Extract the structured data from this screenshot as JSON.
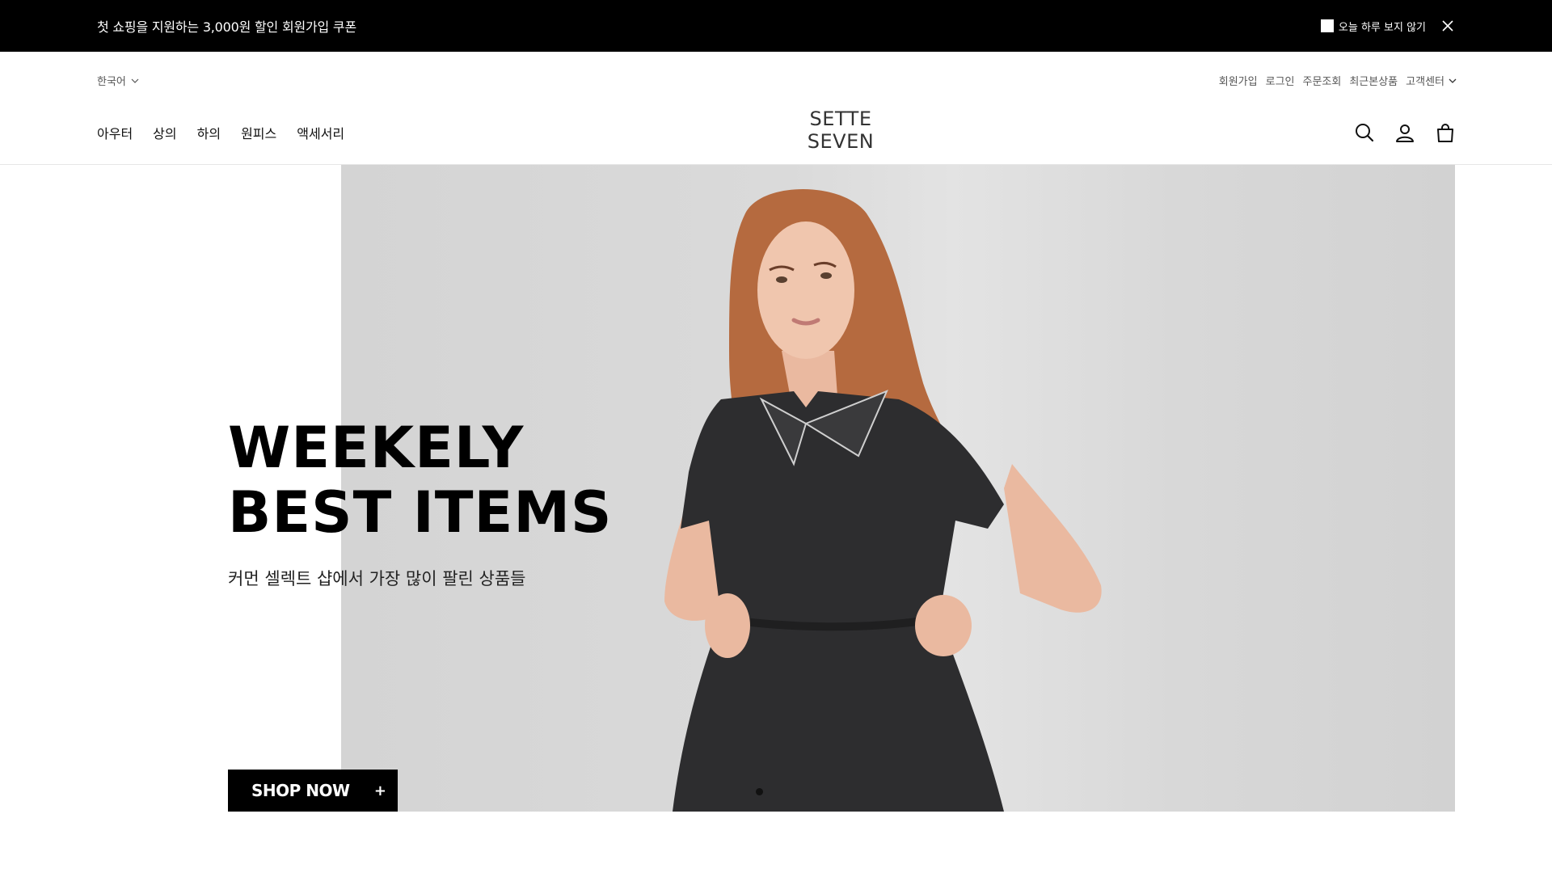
{
  "promo": {
    "text": "첫 쇼핑을 지원하는 3,000원 할인 회원가입 쿠폰",
    "hide_today": "오늘 하루 보지 않기"
  },
  "header": {
    "language": "한국어",
    "util_links": {
      "signup": "회원가입",
      "login": "로그인",
      "order_lookup": "주문조회",
      "recent": "최근본상품",
      "customer_center": "고객센터"
    },
    "nav": {
      "outer": "아우터",
      "tops": "상의",
      "bottoms": "하의",
      "onepiece": "원피스",
      "accessories": "액세서리"
    },
    "logo": {
      "line1": "SETTE",
      "line2": "SEVEN"
    },
    "icons": [
      "search-icon",
      "user-icon",
      "bag-icon"
    ]
  },
  "hero": {
    "title_line1": "WEEKELY",
    "title_line2": "BEST ITEMS",
    "subtitle": "커먼 셀렉트 샵에서 가장 많이 팔린 상품들",
    "cta_label": "SHOP NOW",
    "cta_icon": "+"
  },
  "colors": {
    "promo_bg": "#000000",
    "hero_bg": "#d6d6d6",
    "cta_bg": "#000000",
    "text": "#111111"
  }
}
